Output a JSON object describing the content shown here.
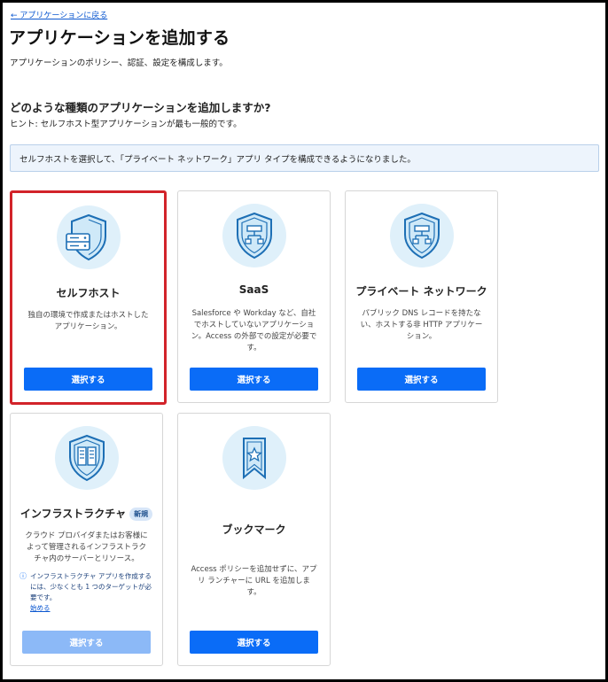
{
  "header": {
    "back_link": "← アプリケーションに戻る",
    "title": "アプリケーションを追加する",
    "subtitle": "アプリケーションのポリシー、認証、設定を構成します。"
  },
  "question": {
    "text": "どのような種類のアプリケーションを追加しますか?",
    "hint": "ヒント: セルフホスト型アプリケーションが最も一般的です。"
  },
  "banner": {
    "text": "セルフホストを選択して、「プライベート ネットワーク」アプリ タイプを構成できるようになりました。"
  },
  "cards": [
    {
      "title": "セルフホスト",
      "description": "独自の環境で作成またはホストしたアプリケーション。",
      "button": "選択する",
      "icon": "server-shield-icon"
    },
    {
      "title": "SaaS",
      "description": "Salesforce や Workday など、自社でホストしていないアプリケーション。Access の外部での設定が必要です。",
      "button": "選択する",
      "icon": "network-shield-icon"
    },
    {
      "title": "プライベート ネットワーク",
      "description": "パブリック DNS レコードを持たない、ホストする非 HTTP アプリケーション。",
      "button": "選択する",
      "icon": "network-shield-icon"
    },
    {
      "title": "インフラストラクチャ",
      "badge": "新規",
      "description": "クラウド プロバイダまたはお客様によって管理されるインフラストラクチャ内のサーバーとリソース。",
      "info_icon": "ⓘ",
      "info_note": "インフラストラクチャ アプリを作成するには、少なくとも 1 つのターゲットが必要です。",
      "info_link": "始める",
      "button": "選択する",
      "icon": "server-rack-shield-icon"
    },
    {
      "title": "ブックマーク",
      "description": "Access ポリシーを追加せずに、アプリ ランチャーに URL を追加します。",
      "button": "選択する",
      "icon": "bookmark-star-icon"
    }
  ],
  "colors": {
    "accent": "#0a6cf7",
    "accent_disabled": "#8cb9f7",
    "icon_bg": "#dff0fa",
    "icon_stroke": "#1d6fb5",
    "selected_border": "#d2232a",
    "banner_bg": "#edf4fc"
  }
}
